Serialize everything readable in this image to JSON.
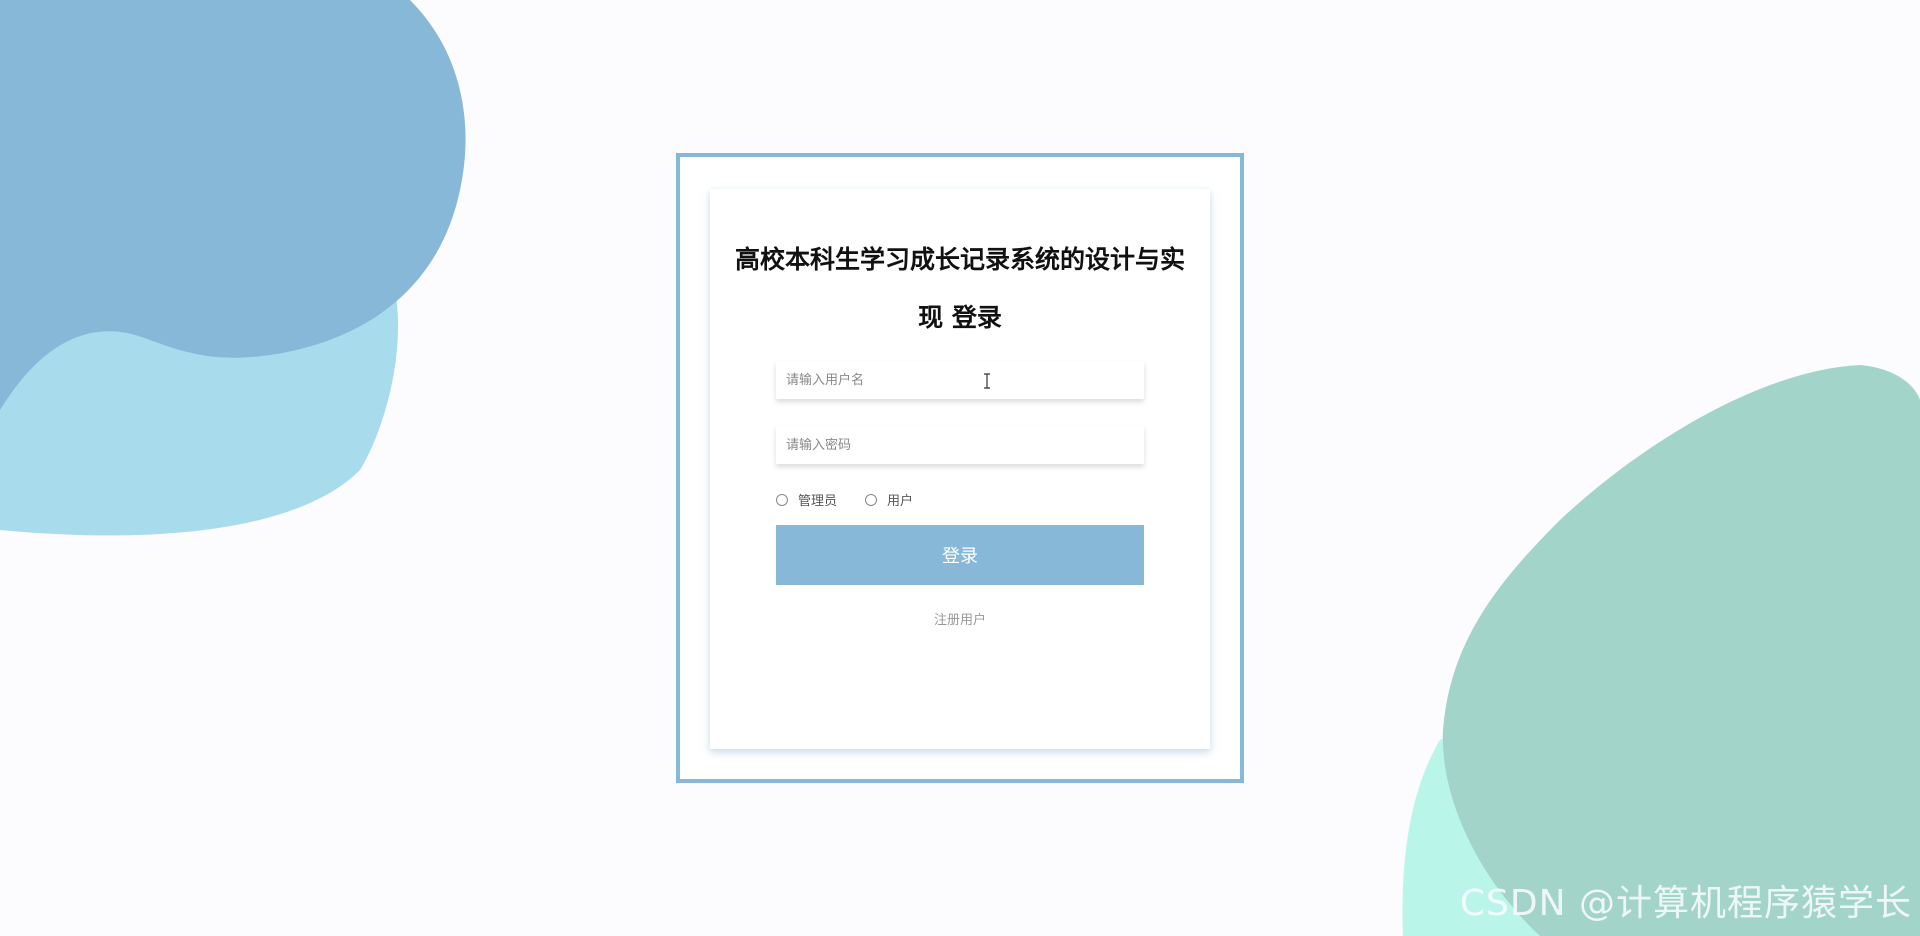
{
  "login": {
    "title": "高校本科生学习成长记录系统的设计与实现 登录",
    "username_placeholder": "请输入用户名",
    "password_placeholder": "请输入密码",
    "roles": [
      "管理员",
      "用户"
    ],
    "login_button": "登录",
    "register_link": "注册用户"
  },
  "watermark": "CSDN @计算机程序猿学长",
  "colors": {
    "background": "#fcfbfe",
    "accent": "#88b8d7",
    "blob_blue_dark": "#87b8d7",
    "blob_blue_light": "#a8dbec",
    "blob_green": "#a2d4c9",
    "blob_mint": "#b9f5e8"
  },
  "icons": {
    "text_cursor": "i-beam-cursor-icon"
  }
}
